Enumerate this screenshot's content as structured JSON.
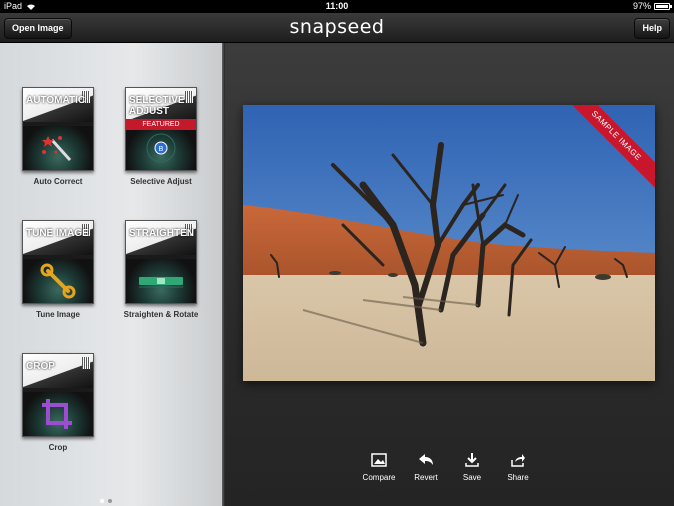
{
  "status_bar": {
    "device": "iPad",
    "time": "11:00",
    "battery": "97%",
    "battery_level": 0.97
  },
  "toolbar": {
    "open_image": "Open Image",
    "logo": "snapseed",
    "help": "Help"
  },
  "tools": [
    {
      "card_title": [
        "AUTOMATIC"
      ],
      "label": "Auto Correct",
      "icon": "magic-wand-icon"
    },
    {
      "card_title": [
        "SELECTIVE",
        "ADJUST"
      ],
      "badge": "FEATURED",
      "label": "Selective Adjust",
      "icon": "control-point-icon"
    },
    {
      "card_title": [
        "TUNE IMAGE"
      ],
      "label": "Tune Image",
      "icon": "wrench-icon"
    },
    {
      "card_title": [
        "STRAIGHTEN"
      ],
      "label": "Straighten & Rotate",
      "icon": "level-icon"
    },
    {
      "card_title": [
        "CROP"
      ],
      "label": "Crop",
      "icon": "crop-icon"
    }
  ],
  "photo": {
    "ribbon": "SAMPLE IMAGE"
  },
  "actions": [
    {
      "label": "Compare",
      "icon": "image-icon"
    },
    {
      "label": "Revert",
      "icon": "revert-arrow-icon"
    },
    {
      "label": "Save",
      "icon": "save-download-icon"
    },
    {
      "label": "Share",
      "icon": "share-icon"
    }
  ],
  "pagination": {
    "current": 1,
    "total": 2
  },
  "colors": {
    "accent_red": "#c4192b",
    "sidebar": "#dfe2e4",
    "canvas": "#2e2e2e"
  }
}
